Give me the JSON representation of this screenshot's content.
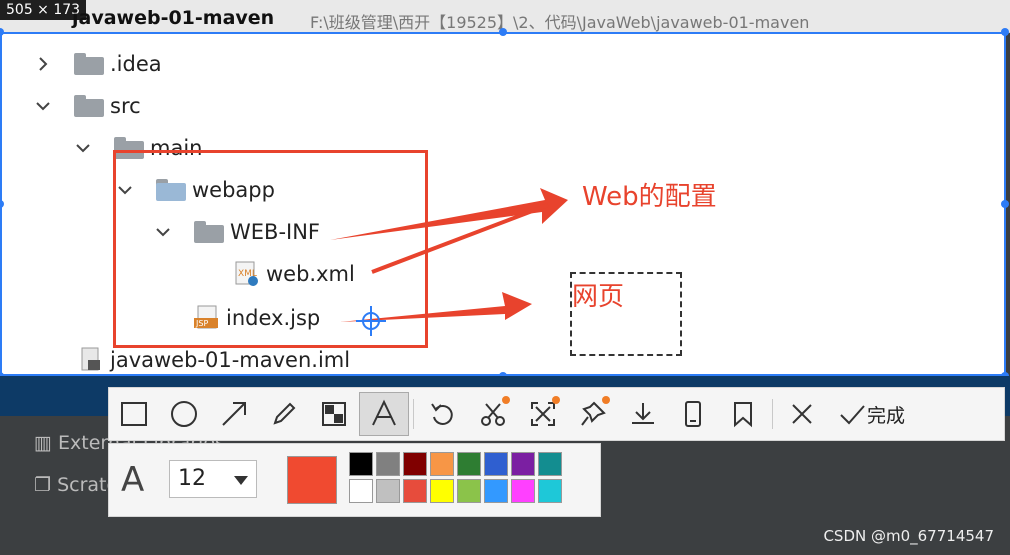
{
  "header": {
    "size_badge": "505 × 173",
    "project_name": "javaweb-01-maven",
    "project_path": "F:\\班级管理\\西开【19525】\\2、代码\\JavaWeb\\javaweb-01-maven"
  },
  "tree": {
    "idea": ".idea",
    "src": "src",
    "main": "main",
    "webapp": "webapp",
    "webinf": "WEB-INF",
    "webxml": "web.xml",
    "indexjsp": "index.jsp",
    "iml": "javaweb-01-maven.iml"
  },
  "annotations": {
    "web_config": "Web的配置",
    "webpage": "网页"
  },
  "lower_panel": {
    "external_libraries": "External Libraries",
    "scratches": "Scratches and Consoles"
  },
  "toolbar": {
    "done_label": "完成",
    "colors": {
      "accent": "#f07d26"
    }
  },
  "font_panel": {
    "font_size": "12",
    "current_color": "#f04a30",
    "swatches": [
      "#000000",
      "#808080",
      "#800000",
      "#f79646",
      "#2e7d32",
      "#2f5fd0",
      "#7b1fa2",
      "#138d90",
      "#ffffff",
      "#c0c0c0",
      "#e74c3c",
      "#ffff00",
      "#8bc34a",
      "#3399ff",
      "#ff40ff",
      "#1ec8d8"
    ]
  },
  "watermark": "CSDN @m0_67714547"
}
